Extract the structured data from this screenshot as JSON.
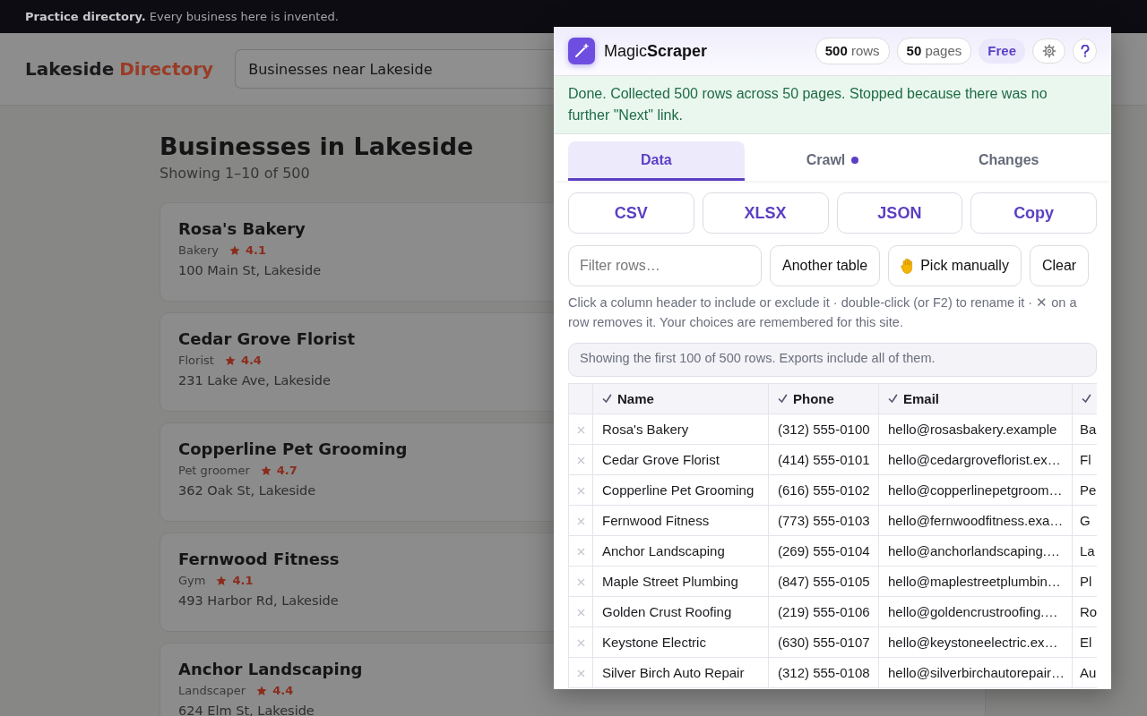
{
  "notice": "**Practice directory.** Every business here is invented.",
  "site": {
    "brand": [
      "Lakeside",
      "Directory"
    ],
    "search": {
      "value": "Businesses near Lakeside"
    }
  },
  "listing": {
    "title": "Businesses in Lakeside",
    "subtitle": "Showing 1–10 of 500",
    "businesses": [
      {
        "name": "Rosa's Bakery",
        "category": "Bakery",
        "rating": "4.1",
        "address": "100 Main St, Lakeside"
      },
      {
        "name": "Cedar Grove Florist",
        "category": "Florist",
        "rating": "4.4",
        "address": "231 Lake Ave, Lakeside"
      },
      {
        "name": "Copperline Pet Grooming",
        "category": "Pet groomer",
        "rating": "4.7",
        "address": "362 Oak St, Lakeside"
      },
      {
        "name": "Fernwood Fitness",
        "category": "Gym",
        "rating": "4.1",
        "address": "493 Harbor Rd, Lakeside"
      },
      {
        "name": "Anchor Landscaping",
        "category": "Landscaper",
        "rating": "4.4",
        "address": "624 Elm St, Lakeside"
      }
    ]
  },
  "panel": {
    "title": "Magic**Scraper**",
    "stats": [
      "**500** rows",
      "**50** pages"
    ],
    "plan": "Free",
    "status": "Done. Collected 500 rows across 50 pages. Stopped because there was no further \"Next\" link.",
    "tabs": [
      {
        "label": "Data",
        "selected": true,
        "indicator": false
      },
      {
        "label": "Crawl",
        "selected": false,
        "indicator": true
      },
      {
        "label": "Changes",
        "selected": false,
        "indicator": false
      }
    ],
    "exports": [
      "CSV",
      "XLSX",
      "JSON",
      "Copy"
    ],
    "filter": {
      "placeholder": "Filter rows…"
    },
    "actions": [
      {
        "label": "Another table",
        "kind": "plain"
      },
      {
        "label": "Pick manually",
        "kind": "hand"
      },
      {
        "label": "Clear",
        "kind": "plain"
      }
    ],
    "help": "Click a column header to include or exclude it · double-click (or F2) to rename it · ✕ on a row removes it. Your choices are remembered for this site.",
    "notice": "Showing the first 100 of 500 rows. Exports include all of them.",
    "table": {
      "columns": [
        {
          "label": "Name",
          "checked": true
        },
        {
          "label": "Phone",
          "checked": true
        },
        {
          "label": "Email",
          "checked": true
        },
        {
          "checked": true
        }
      ],
      "rows": [
        [
          "Rosa's Bakery",
          "(312) 555-0100",
          "hello@rosasbakery.example",
          "Ba"
        ],
        [
          "Cedar Grove Florist",
          "(414) 555-0101",
          "hello@cedargroveflorist.ex…",
          "Fl"
        ],
        [
          "Copperline Pet Grooming",
          "(616) 555-0102",
          "hello@copperlinepetgroom…",
          "Pe"
        ],
        [
          "Fernwood Fitness",
          "(773) 555-0103",
          "hello@fernwoodfitness.exa…",
          "G"
        ],
        [
          "Anchor Landscaping",
          "(269) 555-0104",
          "hello@anchorlandscaping.…",
          "La"
        ],
        [
          "Maple Street Plumbing",
          "(847) 555-0105",
          "hello@maplestreetplumbin…",
          "Pl"
        ],
        [
          "Golden Crust Roofing",
          "(219) 555-0106",
          "hello@goldencrustroofing.…",
          "Ro"
        ],
        [
          "Keystone Electric",
          "(630) 555-0107",
          "hello@keystoneelectric.ex…",
          "El"
        ],
        [
          "Silver Birch Auto Repair",
          "(312) 555-0108",
          "hello@silverbirchautorepair…",
          "Au"
        ]
      ]
    }
  }
}
